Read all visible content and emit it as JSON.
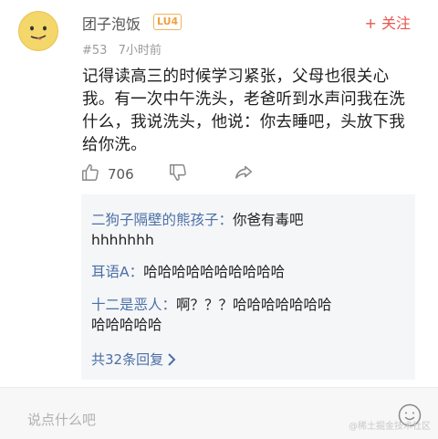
{
  "user": {
    "name": "团子泡饭",
    "level": "LU4",
    "follow_label": "+ 关注"
  },
  "meta": {
    "floor": "#53",
    "time": "7小时前"
  },
  "post": {
    "lines": [
      "记得读高三的时候学习紧张，父母也很关心",
      "我。有一次中午洗头，老爸听到水声问我在洗",
      "什么，我说洗头，他说：你去睡吧，头放下我",
      "给你洗。"
    ]
  },
  "actions": {
    "like_count": "706",
    "icons": [
      "thumbs-up-icon",
      "thumbs-down-icon",
      "share-icon"
    ]
  },
  "replies": [
    {
      "nick": "二狗子隔壁的熊孩子：",
      "text_line1": "你爸有毒吧",
      "text_line2": "hhhhhhh"
    },
    {
      "nick": "耳语A：",
      "text_line1": "哈哈哈哈哈哈哈哈哈哈"
    },
    {
      "nick": "十二是恶人：",
      "text_line1": "啊？？？哈哈哈哈哈哈哈",
      "text_line2": "哈哈哈哈哈"
    }
  ],
  "more_replies": "共32条回复",
  "comment_bar": {
    "placeholder": "说点什么吧",
    "emoji_icon": "smiley-icon"
  },
  "watermark": "@稀土掘金技术社区",
  "colors": {
    "accent": "#e8564d",
    "link": "#4a6fa5",
    "level": "#f0a040"
  }
}
